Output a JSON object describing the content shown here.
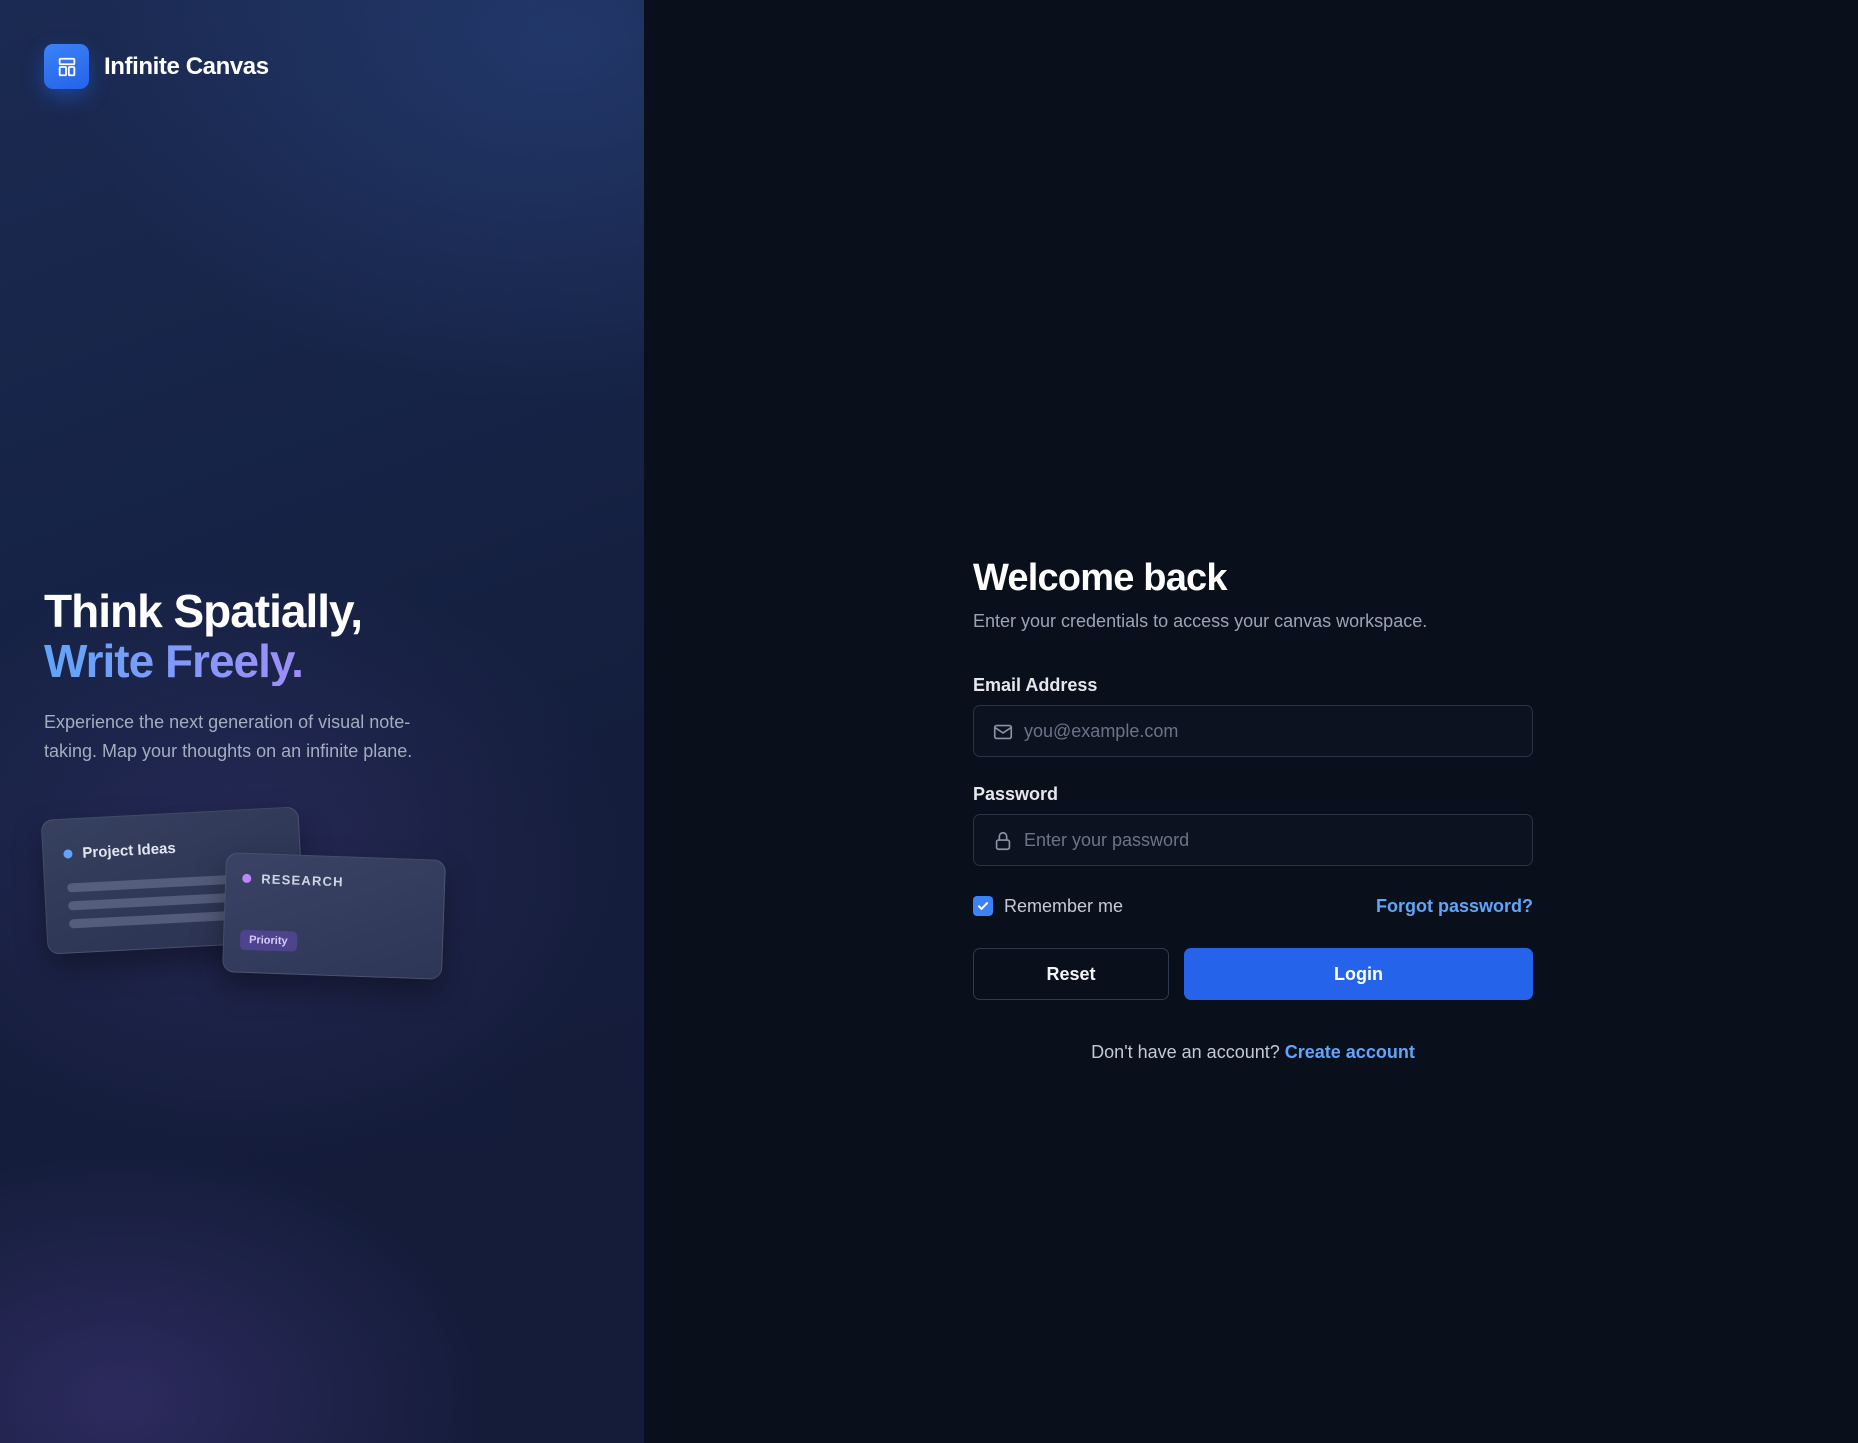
{
  "brand": {
    "name": "Infinite Canvas",
    "icon": "layout-icon",
    "accent": "#2563eb"
  },
  "hero": {
    "line1": "Think Spatially,",
    "line2": "Write Freely.",
    "description": "Experience the next generation of visual note-taking. Map your thoughts on an infinite plane."
  },
  "illustration": {
    "card_a": {
      "title": "Project Ideas",
      "dot_color": "#60a5fa"
    },
    "card_b": {
      "title": "RESEARCH",
      "dot_color": "#c084fc",
      "chip": "Priority"
    }
  },
  "login": {
    "title": "Welcome back",
    "subtitle": "Enter your credentials to access your canvas workspace.",
    "email": {
      "label": "Email Address",
      "placeholder": "you@example.com",
      "value": "",
      "icon": "mail-icon"
    },
    "password": {
      "label": "Password",
      "placeholder": "Enter your password",
      "value": "",
      "icon": "lock-icon"
    },
    "remember": {
      "label": "Remember me",
      "checked": true
    },
    "forgot_label": "Forgot password?",
    "reset_label": "Reset",
    "login_label": "Login",
    "signup_prompt": "Don't have an account?",
    "signup_link": "Create account"
  },
  "colors": {
    "link": "#60a5fa",
    "primary_button": "#2563eb",
    "background": "#0a0f1c"
  }
}
